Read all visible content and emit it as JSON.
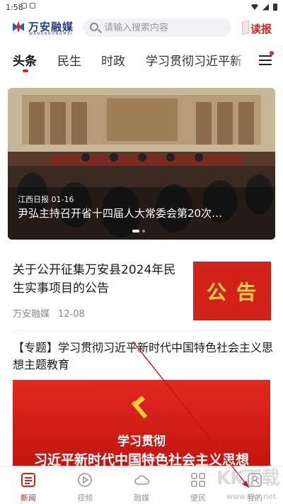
{
  "status_bar": {
    "time": "1:58"
  },
  "header": {
    "logo_text": "万安融媒",
    "logo_sub": "WANANRONGMEI",
    "search_placeholder": "请输入搜索内容",
    "read_label": "读报"
  },
  "tabs": [
    {
      "label": "头条",
      "active": true
    },
    {
      "label": "民生",
      "active": false
    },
    {
      "label": "时政",
      "active": false
    },
    {
      "label": "学习贯彻习近平新",
      "active": false
    }
  ],
  "banner": {
    "source": "江西日报",
    "date": "01-16",
    "title": "尹弘主持召开省十四届人大常委会第20次…"
  },
  "news": [
    {
      "title": "关于公开征集万安县2024年民生实事项目的公告",
      "source": "万安融媒",
      "date": "12-08",
      "thumb_text": "公告"
    }
  ],
  "topic": {
    "title": "【专题】学习贯彻习近平新时代中国特色社会主义思想主题教育",
    "image_line1": "学习贯彻",
    "image_line2": "习近平新时代中国特色社会主义思想"
  },
  "bottom_nav": [
    {
      "label": "新闻",
      "icon": "news-icon",
      "active": true
    },
    {
      "label": "视频",
      "icon": "play-icon",
      "active": false
    },
    {
      "label": "融媒",
      "icon": "cloud-icon",
      "active": false
    },
    {
      "label": "便民",
      "icon": "grid-icon",
      "active": false
    },
    {
      "label": "我的",
      "icon": "user-icon",
      "active": false
    }
  ],
  "watermark": {
    "text": "KK下载",
    "url": "www.kkx.net"
  },
  "colors": {
    "accent": "#d9251c",
    "brand_blue": "#1f3e8c",
    "topic_red": "#d2221a",
    "thumb_text": "#f3d04a"
  }
}
